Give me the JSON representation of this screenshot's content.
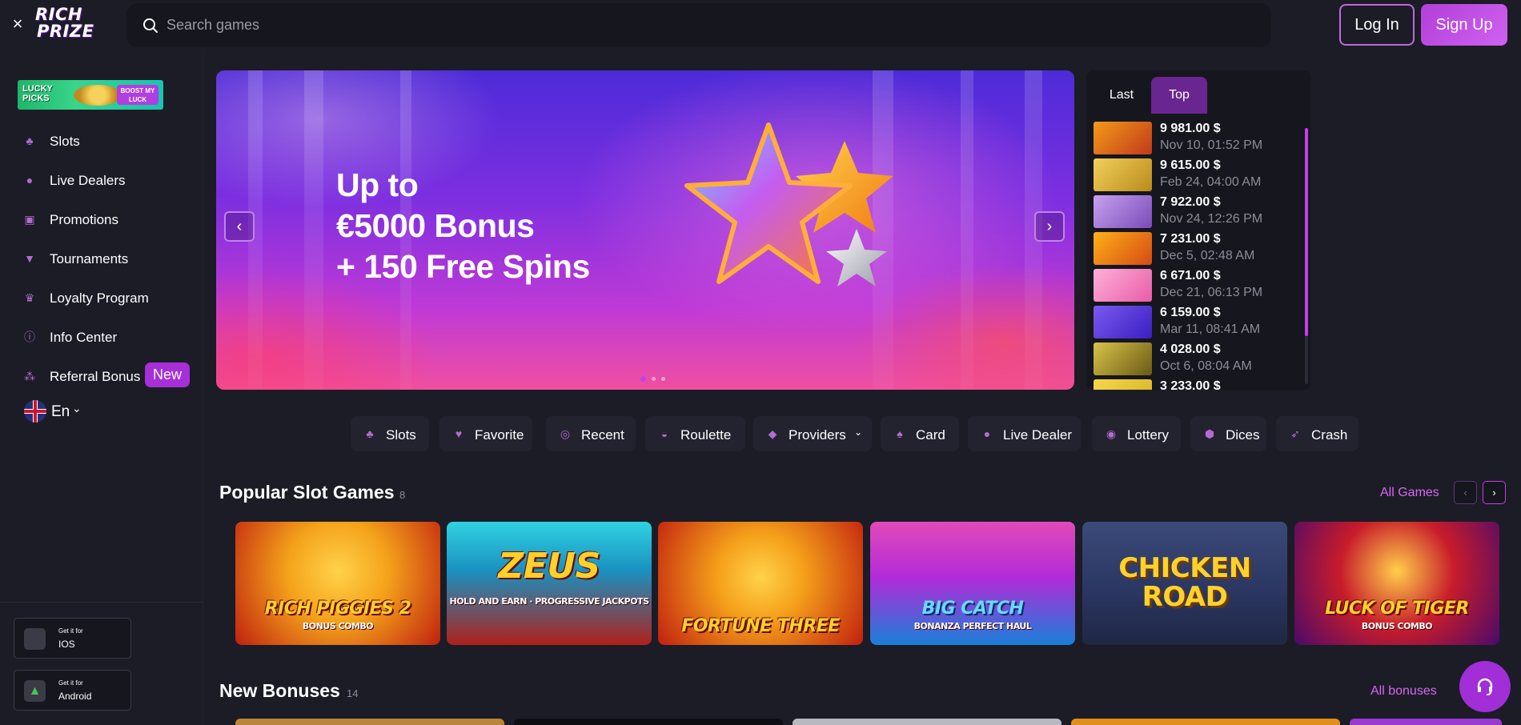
{
  "header": {
    "close_label": "×",
    "logo_line1": "RICH",
    "logo_line2": "PRIZE",
    "search_placeholder": "Search games",
    "login_label": "Log In",
    "signup_label": "Sign Up"
  },
  "sidebar": {
    "promo": {
      "line1": "LUCKY",
      "line2": "PICKS",
      "button": "BOOST MY LUCK"
    },
    "items": [
      {
        "label": "Slots",
        "icon": "cherries-icon"
      },
      {
        "label": "Live Dealers",
        "icon": "person-icon"
      },
      {
        "label": "Promotions",
        "icon": "gift-icon"
      },
      {
        "label": "Tournaments",
        "icon": "trophy-icon"
      },
      {
        "label": "Loyalty Program",
        "icon": "crown-icon"
      },
      {
        "label": "Info Center",
        "icon": "info-icon"
      },
      {
        "label": "Referral Bonus",
        "icon": "group-icon",
        "badge": "New"
      }
    ],
    "language": "En",
    "stores": [
      {
        "small": "Get it for",
        "name": "IOS",
        "icon": "apple-icon"
      },
      {
        "small": "Get it for",
        "name": "Android",
        "icon": "android-icon"
      }
    ]
  },
  "banner": {
    "line1": "Up to",
    "line2": "€5000 Bonus",
    "line3": "+ 150 Free Spins",
    "prev": "‹",
    "next": "›",
    "active_slide": 1,
    "slide_count": 3
  },
  "winners": {
    "tabs": [
      "Last",
      "Top"
    ],
    "active_tab": "Top",
    "rows": [
      {
        "amount": "9 981.00 $",
        "date": "Nov 10, 01:52 PM",
        "color": "#c23a1a"
      },
      {
        "amount": "9 615.00 $",
        "date": "Feb 24, 04:00 AM",
        "color": "#b98a1c"
      },
      {
        "amount": "7 922.00 $",
        "date": "Nov 24, 12:26 PM",
        "color": "#7a4ab8"
      },
      {
        "amount": "7 231.00 $",
        "date": "Dec 5, 02:48 AM",
        "color": "#d44a12"
      },
      {
        "amount": "6 671.00 $",
        "date": "Dec 21, 06:13 PM",
        "color": "#e85ca8"
      },
      {
        "amount": "6 159.00 $",
        "date": "Mar 11, 08:41 AM",
        "color": "#5a2ee0"
      },
      {
        "amount": "4 028.00 $",
        "date": "Oct 6, 08:04 AM",
        "color": "#9a8a1c"
      },
      {
        "amount": "3 233.00 $",
        "date": "",
        "color": "#d8b020"
      }
    ]
  },
  "categories": [
    {
      "label": "Slots",
      "icon": "cherries-icon"
    },
    {
      "label": "Favorite",
      "icon": "heart-icon"
    },
    {
      "label": "Recent",
      "icon": "clock-icon"
    },
    {
      "label": "Roulette",
      "icon": "roulette-icon"
    },
    {
      "label": "Providers",
      "icon": "diamond-icon",
      "dropdown": true
    },
    {
      "label": "Card",
      "icon": "card-icon"
    },
    {
      "label": "Live Dealer",
      "icon": "person-icon"
    },
    {
      "label": "Lottery",
      "icon": "lottery-icon"
    },
    {
      "label": "Dices",
      "icon": "dice-icon"
    },
    {
      "label": "Crash",
      "icon": "rocket-icon"
    }
  ],
  "popular": {
    "title": "Popular Slot Games",
    "count": "8",
    "link": "All Games",
    "prev": "‹",
    "next": "›",
    "games": [
      {
        "title": "RICH PIGGIES 2",
        "sub": "BONUS COMBO",
        "bg1": "#f4a21a",
        "bg2": "#c0200f"
      },
      {
        "title": "ZEUS",
        "sub": "HOLD AND EARN · PROGRESSIVE JACKPOTS",
        "bg1": "#2fd2e0",
        "bg2": "#b0201a"
      },
      {
        "title": "FORTUNE THREE",
        "sub": "",
        "bg1": "#f5a01a",
        "bg2": "#c11f0f"
      },
      {
        "title": "BIG CATCH",
        "sub": "BONANZA PERFECT HAUL",
        "bg1": "#b22bd8",
        "bg2": "#1a7fd8"
      },
      {
        "title": "CHICKEN ROAD",
        "sub": "",
        "bg1": "#3b4a7a",
        "bg2": "#1f2744"
      },
      {
        "title": "LUCK OF TIGER",
        "sub": "BONUS COMBO",
        "bg1": "#c81c2a",
        "bg2": "#4a0a6a"
      }
    ]
  },
  "new_bonuses": {
    "title": "New Bonuses",
    "count": "14",
    "link": "All bonuses"
  },
  "colors": {
    "accent": "#c43fe8",
    "bg": "#1b1c26",
    "panel": "#15161e"
  }
}
